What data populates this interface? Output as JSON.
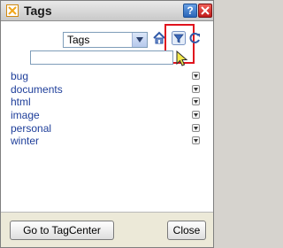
{
  "window": {
    "title": "Tags"
  },
  "titlebar": {
    "help_label": "?"
  },
  "toolbar": {
    "view_select": {
      "value": "Tags",
      "options": [
        "Tags"
      ]
    },
    "filter_input": {
      "value": "",
      "placeholder": ""
    },
    "icons": [
      "home-icon",
      "filter-icon",
      "refresh-icon"
    ],
    "highlight_color": "#e0141e"
  },
  "tags": [
    {
      "label": "bug"
    },
    {
      "label": "documents"
    },
    {
      "label": "html"
    },
    {
      "label": "image"
    },
    {
      "label": "personal"
    },
    {
      "label": "winter"
    }
  ],
  "footer": {
    "tagcenter_label": "Go to TagCenter",
    "close_label": "Close"
  },
  "colors": {
    "link": "#1e3e9a",
    "title_icon": "#f2a71b",
    "close_button": "#c11a1a",
    "help_button": "#2b66b8"
  }
}
